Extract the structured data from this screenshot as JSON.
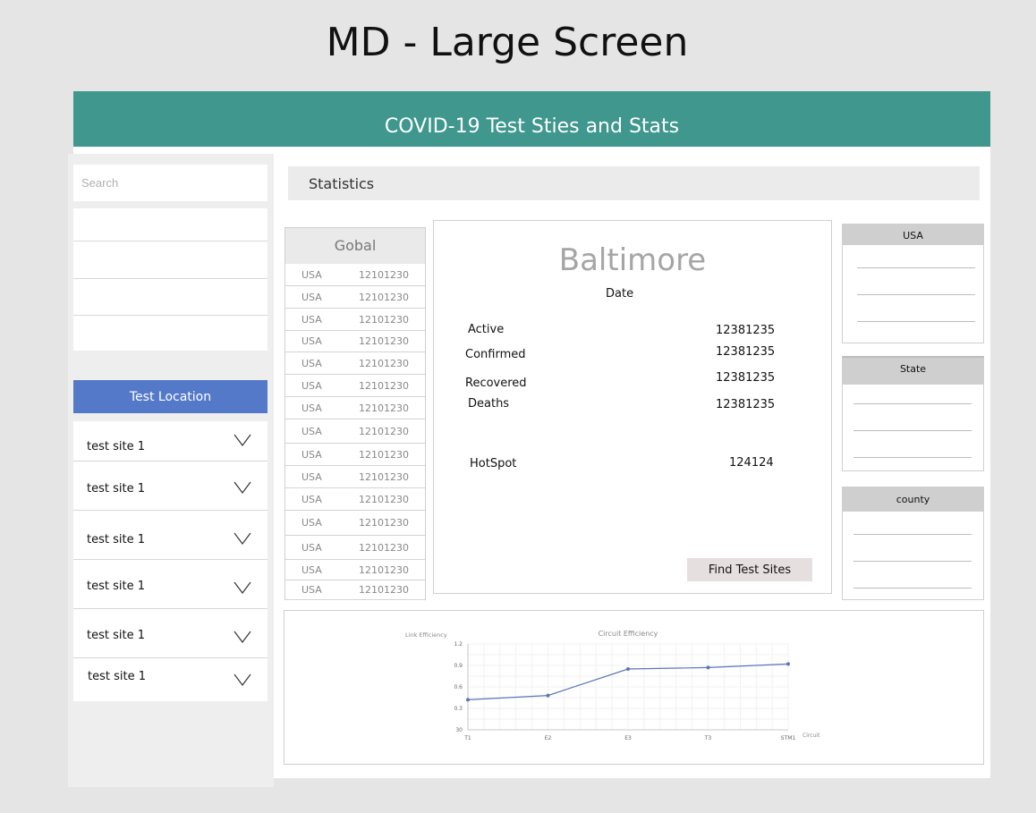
{
  "page_heading": "MD - Large Screen",
  "app_title": "COVID-19 Test Sties and Stats",
  "search": {
    "placeholder": "Search"
  },
  "test_location_label": "Test Location",
  "test_sites": [
    "test site 1",
    "test site 1",
    "test site 1",
    "test site 1",
    "test site 1",
    "test site 1"
  ],
  "statistics_label": "Statistics",
  "global": {
    "heading": "Gobal",
    "rows": [
      [
        "USA",
        "12101230"
      ],
      [
        "USA",
        "12101230"
      ],
      [
        "USA",
        "12101230"
      ],
      [
        "USA",
        "12101230"
      ],
      [
        "USA",
        "12101230"
      ],
      [
        "USA",
        "12101230"
      ],
      [
        "USA",
        "12101230"
      ],
      [
        "USA",
        "12101230"
      ],
      [
        "USA",
        "12101230"
      ],
      [
        "USA",
        "12101230"
      ],
      [
        "USA",
        "12101230"
      ],
      [
        "USA",
        "12101230"
      ],
      [
        "USA",
        "12101230"
      ],
      [
        "USA",
        "12101230"
      ],
      [
        "USA",
        "12101230"
      ]
    ]
  },
  "city": {
    "name": "Baltimore",
    "date_label": "Date",
    "active_label": "Active",
    "active_value": "12381235",
    "confirmed_label": "Confirmed",
    "confirmed_value": "12381235",
    "recovered_label": "Recovered",
    "recovered_value": "12381235",
    "deaths_label": "Deaths",
    "deaths_value": "12381235",
    "hotspot_label": "HotSpot",
    "hotspot_value": "124124",
    "find_button": "Find Test Sites"
  },
  "side_panels": [
    "USA",
    "State",
    "county"
  ],
  "colors": {
    "header": "#3f978e",
    "test_location": "#5479c9",
    "series": "#5b76b8"
  },
  "chart_data": {
    "type": "line",
    "title": "Circuit Efficiency",
    "ylabel": "Link Efficiency",
    "xlabel": "Circuit",
    "categories": [
      "T1",
      "E2",
      "E3",
      "T3",
      "STM1"
    ],
    "values": [
      0.42,
      0.48,
      0.85,
      0.87,
      0.92
    ],
    "ylim": [
      0,
      1.2
    ],
    "yticks": [
      "30",
      "0.3",
      "0.6",
      "0.9",
      "1.2"
    ],
    "grid": true
  }
}
